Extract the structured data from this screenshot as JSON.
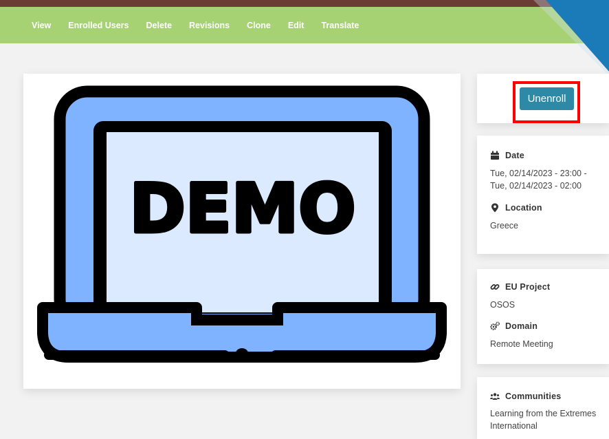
{
  "tabs": [
    "View",
    "Enrolled Users",
    "Delete",
    "Revisions",
    "Clone",
    "Edit",
    "Translate"
  ],
  "image": {
    "text": "DEMO"
  },
  "enroll": {
    "button_label": "Unenroll"
  },
  "event": {
    "date_label": "Date",
    "date_value_line1": "Tue, 02/14/2023 - 23:00 -",
    "date_value_line2": "Tue, 02/14/2023 - 02:00",
    "location_label": "Location",
    "location_value": "Greece"
  },
  "project": {
    "eu_project_label": "EU Project",
    "eu_project_value": "OSOS",
    "domain_label": "Domain",
    "domain_value": "Remote Meeting"
  },
  "communities": {
    "label": "Communities",
    "value_line1": "Learning from the Extremes",
    "value_line2": "International"
  },
  "icons": {
    "date": "calendar-icon",
    "location": "map-marker-icon",
    "eu_project": "link-icon",
    "domain": "cogs-icon",
    "communities": "users-icon"
  },
  "colors": {
    "tabbar": "#a6d274",
    "button": "#2e89a6",
    "highlight": "#ff0000",
    "laptop_frame": "#7fb3ff",
    "laptop_screen": "#dbeafe",
    "corner": "#1a7bb8"
  }
}
